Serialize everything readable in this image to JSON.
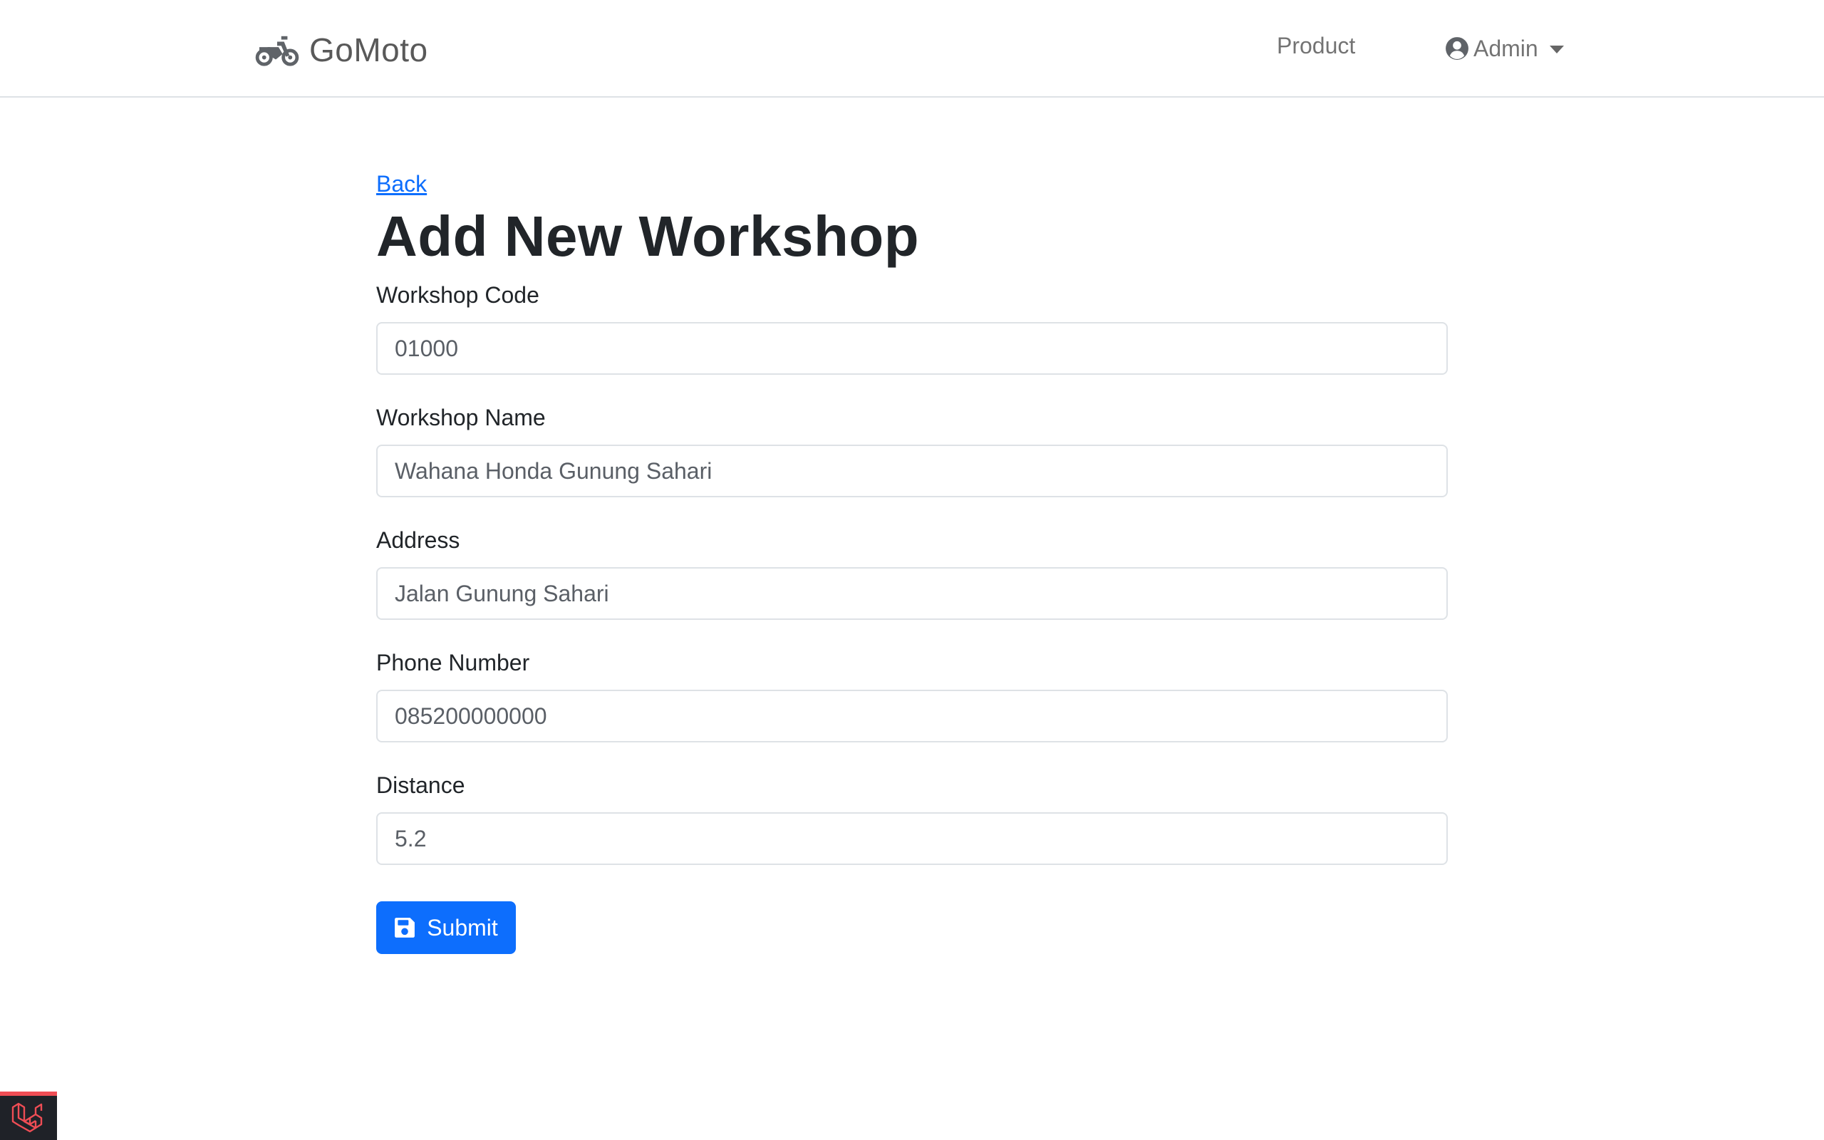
{
  "navbar": {
    "brand": "GoMoto",
    "brand_icon": "motorcycle-icon",
    "product_link": "Product",
    "user_menu": {
      "label": "Admin",
      "icon": "user-circle-icon"
    }
  },
  "page": {
    "back_link": "Back",
    "title": "Add New Workshop"
  },
  "form": {
    "fields": [
      {
        "label": "Workshop Code",
        "value": "01000"
      },
      {
        "label": "Workshop Name",
        "value": "Wahana Honda Gunung Sahari"
      },
      {
        "label": "Address",
        "value": "Jalan Gunung Sahari"
      },
      {
        "label": "Phone Number",
        "value": "085200000000"
      },
      {
        "label": "Distance",
        "value": "5.2"
      }
    ],
    "submit_label": "Submit",
    "submit_icon": "save-icon"
  },
  "debug_badge": {
    "icon": "laravel-icon"
  },
  "colors": {
    "primary": "#0d6efd",
    "text": "#212529",
    "border": "#dee2e6",
    "badge_bg": "#1f2228",
    "badge_accent": "#ef4d55"
  }
}
